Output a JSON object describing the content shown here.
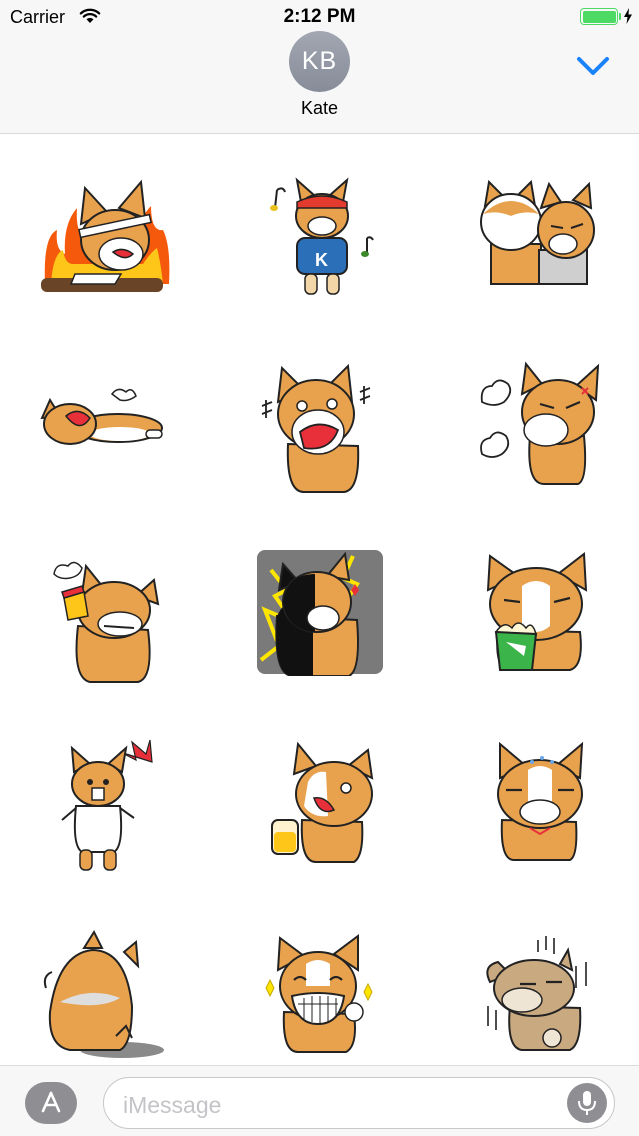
{
  "status_bar": {
    "carrier": "Carrier",
    "time": "2:12 PM",
    "battery_level": 1.0,
    "icons": [
      "wifi-icon",
      "battery-icon",
      "charging-bolt-icon"
    ]
  },
  "header": {
    "avatar_initials": "KB",
    "contact_name": "Kate",
    "collapse_icon": "chevron-down-icon",
    "accent_color": "#1a82fb"
  },
  "stickers": [
    {
      "id": "corgi-studying-on-fire"
    },
    {
      "id": "corgi-cheerleader-singing"
    },
    {
      "id": "shiba-and-corgi-smirking"
    },
    {
      "id": "corgi-lying-yawning"
    },
    {
      "id": "corgi-shocked-scream"
    },
    {
      "id": "corgi-angry-huffing"
    },
    {
      "id": "corgi-bottoms-up-drink"
    },
    {
      "id": "corgi-lightning-shock"
    },
    {
      "id": "corgi-popcorn-smirk"
    },
    {
      "id": "corgi-standing-startled"
    },
    {
      "id": "corgi-drinking-beer"
    },
    {
      "id": "corgi-sweating-nervous"
    },
    {
      "id": "corgi-sitting-back-view"
    },
    {
      "id": "corgi-grinning-sparkles"
    },
    {
      "id": "corgi-gloomy-rain"
    }
  ],
  "input_bar": {
    "placeholder": "iMessage",
    "app_store_icon": "app-store-icon",
    "mic_icon": "microphone-icon"
  }
}
